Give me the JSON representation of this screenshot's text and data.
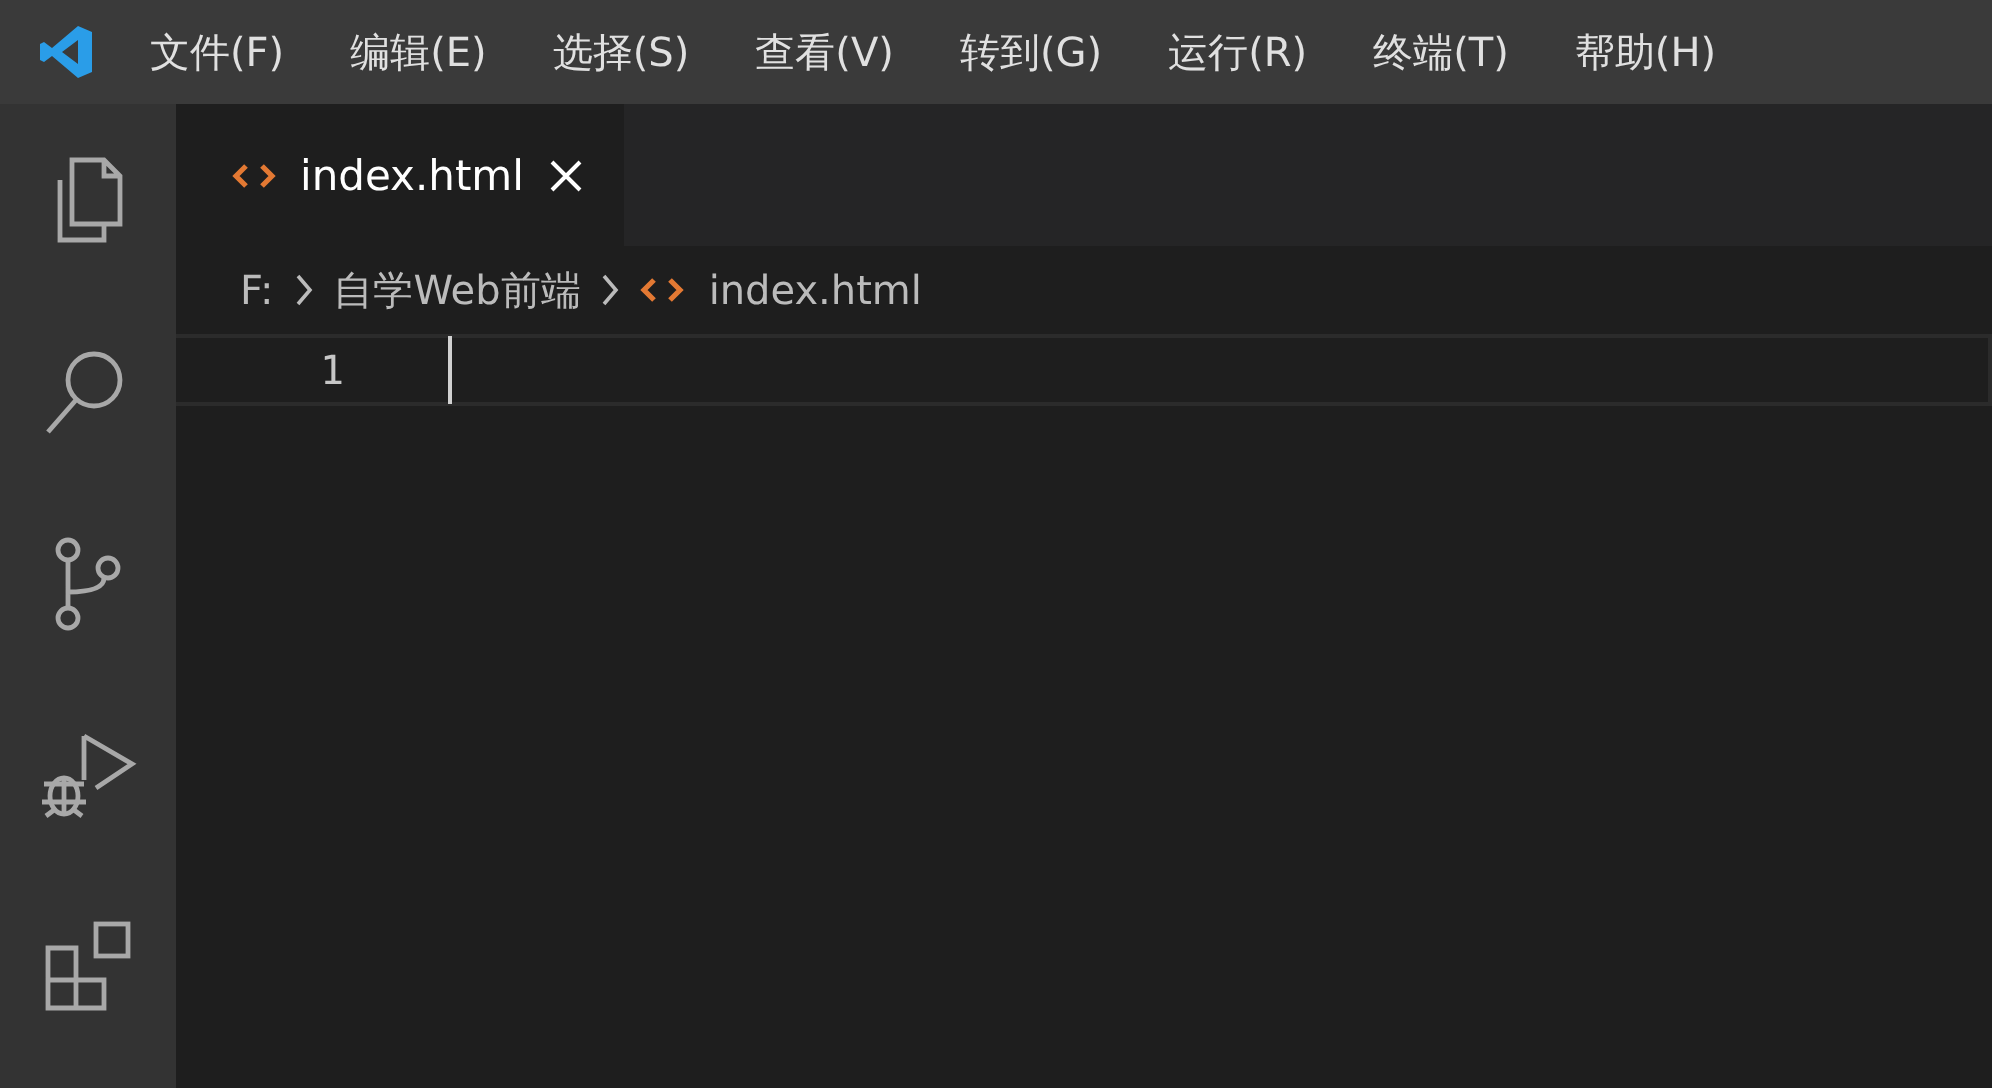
{
  "menu": [
    {
      "label": "文件(F)"
    },
    {
      "label": "编辑(E)"
    },
    {
      "label": "选择(S)"
    },
    {
      "label": "查看(V)"
    },
    {
      "label": "转到(G)"
    },
    {
      "label": "运行(R)"
    },
    {
      "label": "终端(T)"
    },
    {
      "label": "帮助(H)"
    }
  ],
  "tabs": [
    {
      "label": "index.html",
      "selected": true,
      "kind": "html"
    }
  ],
  "breadcrumb": [
    {
      "label": "F:",
      "kind": "folder"
    },
    {
      "label": "自学Web前端",
      "kind": "folder"
    },
    {
      "label": "index.html",
      "kind": "html"
    }
  ],
  "editor": {
    "lines": [
      {
        "number": "1",
        "current": true
      }
    ]
  }
}
